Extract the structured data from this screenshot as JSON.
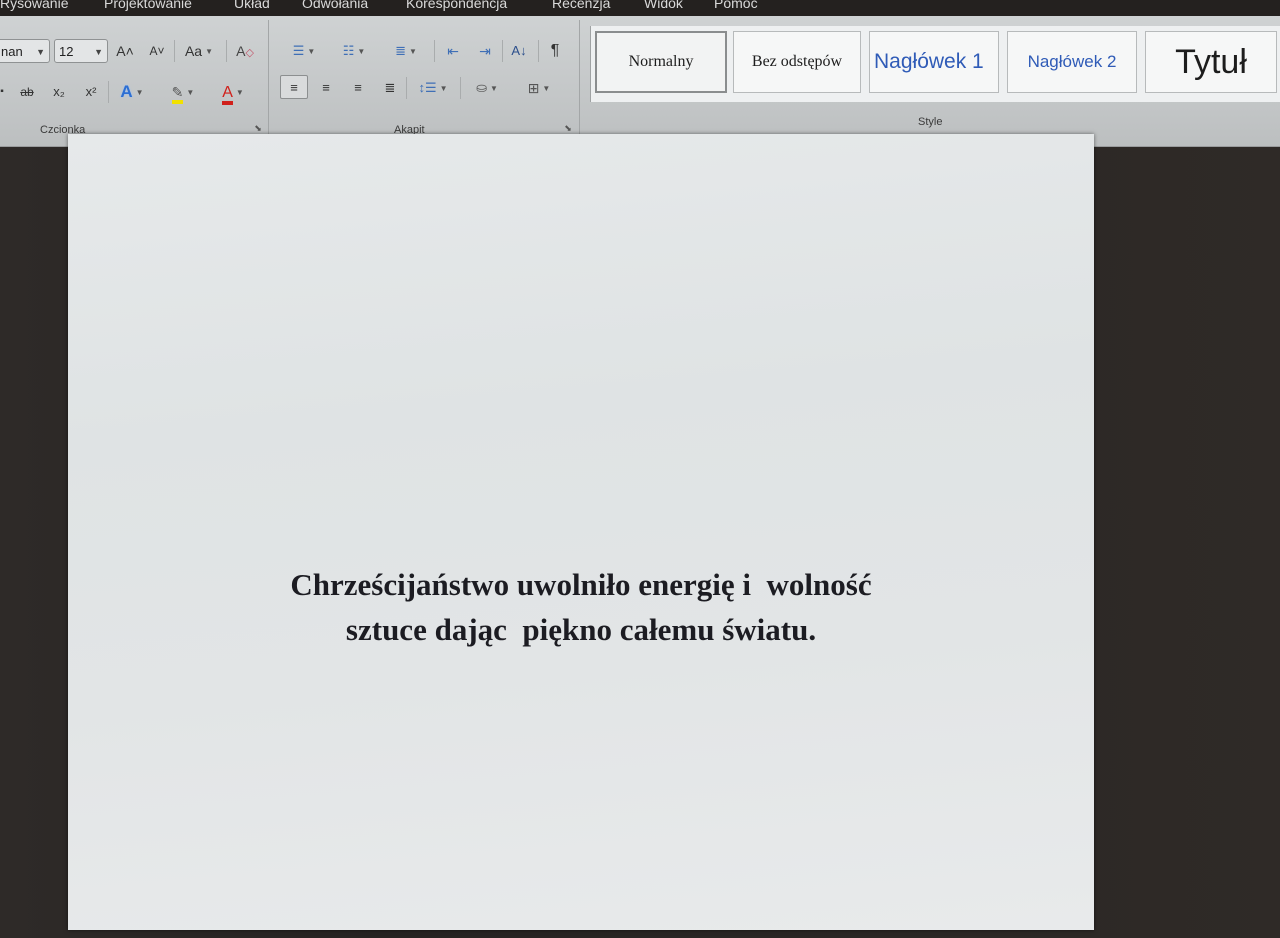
{
  "menu": {
    "tabs": [
      "Rysowanie",
      "Projektowanie",
      "Układ",
      "Odwołania",
      "Korespondencja",
      "Recenzja",
      "Widok",
      "Pomoc"
    ]
  },
  "ribbon": {
    "font": {
      "name_value": "nan",
      "size_value": "12",
      "grow_label": "A˄",
      "shrink_label": "A˅",
      "case_label": "Aa",
      "clear_label": "A",
      "strike_label": "ab",
      "subscript_label": "x₂",
      "superscript_label": "x²",
      "effects_label": "A",
      "highlight_label": "✎",
      "color_label": "A",
      "group_label": "Czcionka"
    },
    "paragraph": {
      "pilcrow_label": "¶",
      "sort_label": "A↓",
      "group_label": "Akapit"
    },
    "styles": {
      "items": [
        "Normalny",
        "Bez odstępów",
        "Nagłówek 1",
        "Nagłówek 2",
        "Tytuł"
      ],
      "group_label": "Style"
    }
  },
  "document": {
    "lines": [
      "Chrześcijaństwo uwolniło energię i  wolność",
      "sztuce dając  piękno całemu światu."
    ]
  },
  "colors": {
    "heading_blue": "#2f5bb7",
    "font_color_red": "#d0201b",
    "highlight_yellow": "#f2e100",
    "effects_blue": "#2d6fd3"
  }
}
